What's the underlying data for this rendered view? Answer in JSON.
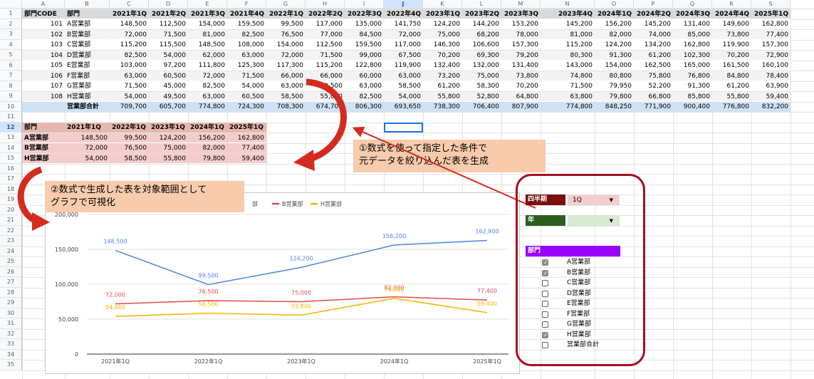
{
  "columns": [
    "A",
    "B",
    "C",
    "D",
    "E",
    "F",
    "G",
    "H",
    "I",
    "J",
    "K",
    "L",
    "M",
    "N",
    "O",
    "P",
    "Q",
    "R",
    "S"
  ],
  "rows": [
    "1",
    "2",
    "3",
    "4",
    "5",
    "6",
    "7",
    "8",
    "9",
    "10",
    "11",
    "12",
    "13",
    "14",
    "15",
    "16",
    "17",
    "18",
    "19",
    "20",
    "21",
    "22",
    "23",
    "24",
    "25",
    "26",
    "27",
    "28",
    "29",
    "30",
    "31",
    "32",
    "33",
    "34",
    "35"
  ],
  "main_table": {
    "header": [
      "部門CODE",
      "部門",
      "2021年1Q",
      "2021年2Q",
      "2021年3Q",
      "2021年4Q",
      "2022年1Q",
      "2022年2Q",
      "2022年3Q",
      "2022年4Q",
      "2023年1Q",
      "2023年2Q",
      "2023年3Q",
      "2023年4Q",
      "2024年1Q",
      "2024年2Q",
      "2024年3Q",
      "2024年4Q",
      "2025年1Q"
    ],
    "rows": [
      [
        "101",
        "A営業部",
        "148,500",
        "112,500",
        "154,000",
        "159,500",
        "99,500",
        "117,000",
        "135,000",
        "141,750",
        "124,200",
        "144,200",
        "153,200",
        "145,200",
        "156,200",
        "145,200",
        "131,400",
        "149,600",
        "162,800"
      ],
      [
        "102",
        "B営業部",
        "72,000",
        "71,500",
        "81,000",
        "82,500",
        "76,500",
        "77,000",
        "84,500",
        "72,000",
        "75,000",
        "68,200",
        "78,000",
        "81,000",
        "82,000",
        "74,000",
        "85,000",
        "73,800",
        "77,400"
      ],
      [
        "103",
        "C営業部",
        "115,200",
        "115,500",
        "148,500",
        "108,000",
        "154,000",
        "112,500",
        "159,500",
        "117,000",
        "146,300",
        "106,600",
        "157,300",
        "115,200",
        "124,200",
        "134,200",
        "162,800",
        "119,900",
        "157,300"
      ],
      [
        "104",
        "D営業部",
        "82,500",
        "54,000",
        "62,000",
        "63,000",
        "72,000",
        "71,500",
        "99,000",
        "67,500",
        "70,200",
        "69,300",
        "79,200",
        "80,300",
        "91,300",
        "61,200",
        "102,300",
        "70,200",
        "72,900"
      ],
      [
        "105",
        "E営業部",
        "103,000",
        "97,200",
        "111,800",
        "125,300",
        "117,300",
        "115,200",
        "122,800",
        "119,900",
        "132,400",
        "132,000",
        "131,400",
        "143,000",
        "154,000",
        "162,500",
        "165,000",
        "161,500",
        "160,100"
      ],
      [
        "106",
        "F営業部",
        "63,000",
        "60,500",
        "72,000",
        "71,500",
        "66,000",
        "66,000",
        "60,000",
        "63,000",
        "73,200",
        "75,000",
        "73,800",
        "74,800",
        "80,800",
        "75,800",
        "76,800",
        "84,800",
        "78,400"
      ],
      [
        "107",
        "G営業部",
        "71,500",
        "45,000",
        "82,500",
        "54,000",
        "63,000",
        "60,500",
        "63,000",
        "58,500",
        "61,200",
        "58,300",
        "70,200",
        "71,500",
        "79,950",
        "52,200",
        "91,300",
        "61,200",
        "63,900"
      ],
      [
        "108",
        "H営業部",
        "54,000",
        "49,500",
        "63,000",
        "60,500",
        "58,500",
        "55,000",
        "82,500",
        "54,000",
        "55,800",
        "52,800",
        "64,800",
        "63,800",
        "79,800",
        "66,800",
        "85,800",
        "55,800",
        "59,400"
      ]
    ],
    "total": [
      "",
      "営業部合計",
      "709,700",
      "605,700",
      "774,800",
      "724,300",
      "708,300",
      "674,700",
      "806,300",
      "693,650",
      "738,300",
      "706,400",
      "807,900",
      "774,800",
      "848,250",
      "771,900",
      "900,400",
      "776,800",
      "832,200"
    ]
  },
  "filtered_table": {
    "header": [
      "部門",
      "2021年1Q",
      "2022年1Q",
      "2023年1Q",
      "2024年1Q",
      "2025年1Q"
    ],
    "rows": [
      [
        "A営業部",
        "148,500",
        "99,500",
        "124,200",
        "156,200",
        "162,800"
      ],
      [
        "B営業部",
        "72,000",
        "76,500",
        "75,000",
        "82,000",
        "77,400"
      ],
      [
        "H営業部",
        "54,000",
        "58,500",
        "55,800",
        "79,800",
        "59,400"
      ]
    ]
  },
  "callouts": {
    "one": [
      "①数式を使って指定した条件で",
      "元データを絞り込んだ表を生成"
    ],
    "two": [
      "②数式で生成した表を対象範囲として",
      "グラフで可視化"
    ]
  },
  "panel": {
    "quarter_label": "四半期",
    "quarter_value": "1Q",
    "year_label": "年",
    "year_value": "",
    "dept_label": "部門",
    "depts": [
      {
        "label": "A営業部",
        "checked": true
      },
      {
        "label": "B営業部",
        "checked": true
      },
      {
        "label": "C営業部",
        "checked": false
      },
      {
        "label": "D営業部",
        "checked": false
      },
      {
        "label": "E営業部",
        "checked": false
      },
      {
        "label": "F営業部",
        "checked": false
      },
      {
        "label": "G営業部",
        "checked": false
      },
      {
        "label": "H営業部",
        "checked": true
      },
      {
        "label": "営業部合計",
        "checked": false
      }
    ]
  },
  "colors": {
    "a": "#4a86e8",
    "b": "#e0494a",
    "h": "#f4b400",
    "panel_border": "#a50f21",
    "callout": "#f8cbad",
    "arrow": "#d52b1e"
  },
  "chart_data": {
    "type": "line",
    "categories": [
      "2021年1Q",
      "2022年1Q",
      "2023年1Q",
      "2024年1Q",
      "2025年1Q"
    ],
    "series": [
      {
        "name": "A営業部",
        "values": [
          148500,
          99500,
          124200,
          156200,
          162800
        ],
        "labels": [
          "148,500",
          "99,500",
          "124,200",
          "156,200",
          "162,800"
        ]
      },
      {
        "name": "B営業部",
        "values": [
          72000,
          76500,
          75000,
          82000,
          77400
        ],
        "labels": [
          "72,000",
          "76,500",
          "75,000",
          "82,000",
          "77,400"
        ]
      },
      {
        "name": "H営業部",
        "values": [
          54000,
          58500,
          55800,
          79800,
          59400
        ],
        "labels": [
          "54,000",
          "58,500",
          "55,800",
          "79,800",
          "59,400"
        ]
      }
    ],
    "legend_visible": [
      "部",
      "B営業部",
      "H営業部"
    ],
    "yticks": [
      "200,000",
      "150,000",
      "100,000",
      "50,000",
      "0"
    ],
    "ylim": [
      0,
      200000
    ],
    "legend": "top"
  }
}
